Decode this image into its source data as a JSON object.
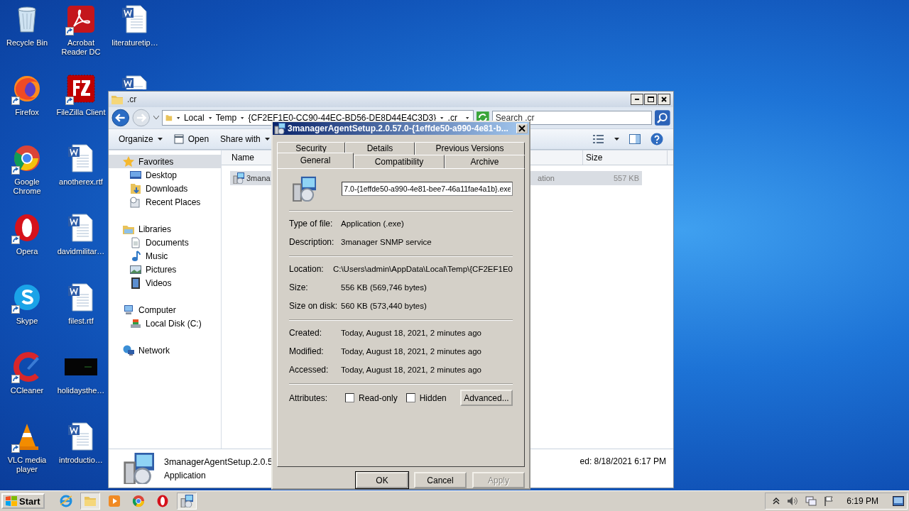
{
  "desktop_icons": [
    {
      "label": "Recycle Bin",
      "kind": "recycle",
      "shortcut": false
    },
    {
      "label": "Firefox",
      "kind": "firefox",
      "shortcut": true
    },
    {
      "label": "Google Chrome",
      "kind": "chrome",
      "shortcut": true
    },
    {
      "label": "Opera",
      "kind": "opera",
      "shortcut": true
    },
    {
      "label": "Skype",
      "kind": "skype",
      "shortcut": true
    },
    {
      "label": "CCleaner",
      "kind": "ccleaner",
      "shortcut": true
    },
    {
      "label": "VLC media player",
      "kind": "vlc",
      "shortcut": true
    },
    {
      "label": "Acrobat Reader DC",
      "kind": "acrobat",
      "shortcut": true
    },
    {
      "label": "FileZilla Client",
      "kind": "filezilla",
      "shortcut": true
    },
    {
      "label": "anotherex.rtf",
      "kind": "word",
      "shortcut": false
    },
    {
      "label": "davidmilitar…",
      "kind": "word",
      "shortcut": false
    },
    {
      "label": "filest.rtf",
      "kind": "word",
      "shortcut": false
    },
    {
      "label": "holidaysthe…",
      "kind": "thumb",
      "shortcut": false
    },
    {
      "label": "introductio…",
      "kind": "word",
      "shortcut": false
    },
    {
      "label": "literaturetip…",
      "kind": "word",
      "shortcut": false
    },
    {
      "kind": "word",
      "shortcut": false
    }
  ],
  "explorer": {
    "title": ".cr",
    "address": [
      "Local",
      "Temp",
      "{CF2EF1E0-CC90-44EC-BD56-DE8D44E4C3D3}",
      ".cr"
    ],
    "search": {
      "placeholder": "Search .cr"
    },
    "toolbar": [
      {
        "label": "Organize",
        "kind": "menu"
      },
      {
        "label": "Open",
        "kind": "open"
      },
      {
        "label": "Share with",
        "kind": "menu"
      }
    ],
    "nav": [
      {
        "label": "Favorites",
        "kind": "star",
        "selected": true,
        "children": [
          {
            "label": "Desktop",
            "kind": "desktop",
            "selected": false
          },
          {
            "label": "Downloads",
            "kind": "downloads",
            "selected": false
          },
          {
            "label": "Recent Places",
            "kind": "recent",
            "selected": false
          }
        ]
      },
      {
        "label": "Libraries",
        "kind": "library",
        "selected": false,
        "children": [
          {
            "label": "Documents",
            "kind": "documents",
            "selected": false
          },
          {
            "label": "Music",
            "kind": "music",
            "selected": false
          },
          {
            "label": "Pictures",
            "kind": "pictures",
            "selected": false
          },
          {
            "label": "Videos",
            "kind": "videos",
            "selected": false
          }
        ]
      },
      {
        "label": "Computer",
        "kind": "computer",
        "selected": false,
        "children": [
          {
            "label": "Local Disk (C:)",
            "kind": "disk",
            "selected": false
          }
        ]
      },
      {
        "label": "Network",
        "kind": "network",
        "selected": false
      }
    ],
    "columns": [
      "Name",
      "Size"
    ],
    "file_row": {
      "name": "3mana",
      "type": "ation",
      "size": "557 KB",
      "selected": true
    },
    "details": {
      "name": "3managerAgentSetup.2.0.5",
      "type": "Application",
      "date": "ed: 8/18/2021 6:17 PM"
    }
  },
  "dialog": {
    "title": "3managerAgentSetup.2.0.57.0-{1effde50-a990-4e81-b...",
    "tab_rows": [
      [
        {
          "label": "Security",
          "selected": false
        },
        {
          "label": "Details",
          "selected": false
        },
        {
          "label": "Previous Versions",
          "selected": false
        }
      ],
      [
        {
          "label": "General",
          "selected": true
        },
        {
          "label": "Compatibility",
          "selected": false
        },
        {
          "label": "Archive",
          "selected": false
        }
      ]
    ],
    "file_name": "7.0-{1effde50-a990-4e81-bee7-46a11fae4a1b}.exe",
    "groups": [
      [
        {
          "label": "Type of file:",
          "value": "Application (.exe)"
        },
        {
          "label": "Description:",
          "value": "3manager SNMP service"
        }
      ],
      [
        {
          "label": "Location:",
          "value": "C:\\Users\\admin\\AppData\\Local\\Temp\\{CF2EF1E0"
        },
        {
          "label": "Size:",
          "value": "556 KB (569,746 bytes)"
        },
        {
          "label": "Size on disk:",
          "value": "560 KB (573,440 bytes)"
        }
      ],
      [
        {
          "label": "Created:",
          "value": "Today, August 18, 2021, 2 minutes ago"
        },
        {
          "label": "Modified:",
          "value": "Today, August 18, 2021, 2 minutes ago"
        },
        {
          "label": "Accessed:",
          "value": "Today, August 18, 2021, 2 minutes ago"
        }
      ]
    ],
    "attributes": {
      "label": "Attributes:",
      "checkboxes": [
        {
          "label": "Read-only",
          "checked": false
        },
        {
          "label": "Hidden",
          "checked": false
        }
      ],
      "button": "Advanced..."
    },
    "buttons": [
      {
        "label": "OK",
        "default": true,
        "disabled": false
      },
      {
        "label": "Cancel",
        "default": false,
        "disabled": false
      },
      {
        "label": "Apply",
        "default": false,
        "disabled": true
      }
    ]
  },
  "taskbar": {
    "start": "Start",
    "items": [
      {
        "kind": "ie",
        "active": false
      },
      {
        "kind": "folder",
        "active": true
      },
      {
        "kind": "media",
        "active": false
      },
      {
        "kind": "chrome",
        "active": false
      },
      {
        "kind": "opera",
        "active": false
      },
      {
        "kind": "installer",
        "active": true
      }
    ],
    "clock": "6:19 PM"
  }
}
